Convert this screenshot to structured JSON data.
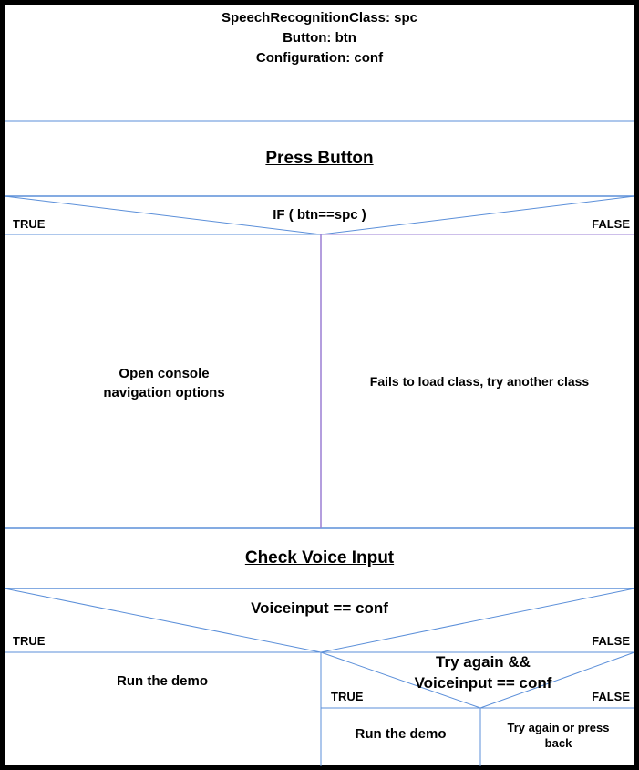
{
  "declarations": {
    "line1": "SpeechRecognitionClass: spc",
    "line2": "Button: btn",
    "line3": "Configuration: conf"
  },
  "step1": {
    "title": "Press Button"
  },
  "decision1": {
    "condition": "IF ( btn==spc )",
    "true_label": "TRUE",
    "false_label": "FALSE",
    "true_action_line1": "Open console",
    "true_action_line2": "navigation options",
    "false_action": "Fails to load class, try another class"
  },
  "step2": {
    "title": "Check Voice Input"
  },
  "decision2": {
    "condition": "Voiceinput == conf",
    "true_label": "TRUE",
    "false_label": "FALSE",
    "true_action": "Run the demo",
    "nested": {
      "condition_line1": "Try again &&",
      "condition_line2": "Voiceinput == conf",
      "true_label": "TRUE",
      "false_label": "FALSE",
      "true_action": "Run the demo",
      "false_action_line1": "Try again or press",
      "false_action_line2": "back"
    }
  },
  "colors": {
    "line": "#5b8fd9",
    "border": "#000000",
    "accent": "#9b7fd4"
  }
}
